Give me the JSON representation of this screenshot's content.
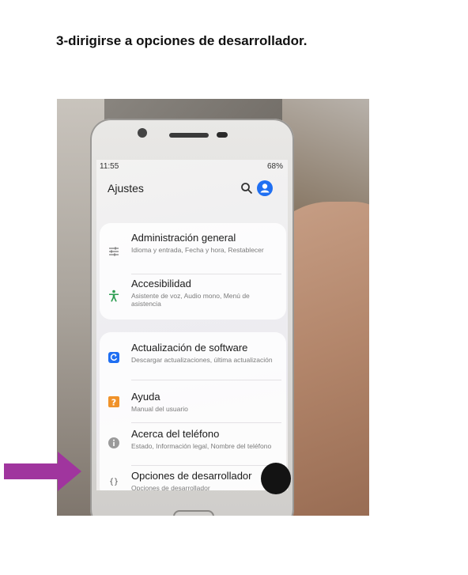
{
  "document": {
    "heading": "3-dirigirse a opciones de desarrollador."
  },
  "phone": {
    "status_time": "11:55",
    "status_battery": "68%",
    "app_title": "Ajustes",
    "icons": {
      "search": "search-icon",
      "account": "account-icon"
    },
    "settings_items": [
      {
        "title": "Administración general",
        "subtitle": "Idioma y entrada, Fecha y hora, Restablecer",
        "icon": "sliders-icon"
      },
      {
        "title": "Accesibilidad",
        "subtitle": "Asistente de voz, Audio mono, Menú de asistencia",
        "icon": "accessibility-icon"
      },
      {
        "title": "Actualización de software",
        "subtitle": "Descargar actualizaciones, última actualización",
        "icon": "update-icon"
      },
      {
        "title": "Ayuda",
        "subtitle": "Manual del usuario",
        "icon": "help-icon"
      },
      {
        "title": "Acerca del teléfono",
        "subtitle": "Estado, Información legal, Nombre del teléfono",
        "icon": "info-icon"
      },
      {
        "title": "Opciones de desarrollador",
        "subtitle": "Opciones de desarrollador",
        "icon": "braces-icon"
      }
    ]
  },
  "colors": {
    "arrow": "#a0359e",
    "accent_blue": "#1f6ff2",
    "accessibility_green": "#2e9e52",
    "help_orange": "#f0922a"
  }
}
